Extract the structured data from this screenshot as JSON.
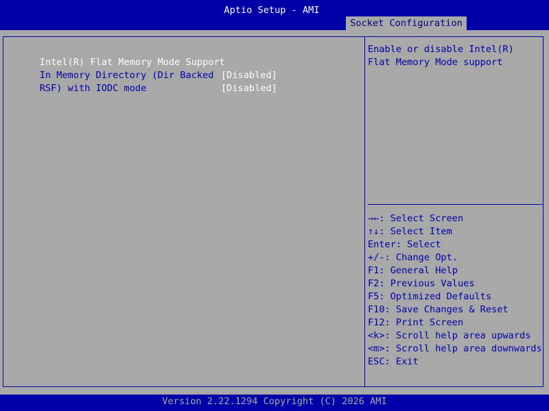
{
  "header": {
    "title": "Aptio Setup - AMI",
    "tab": "Socket Configuration"
  },
  "settings": [
    {
      "label_line1": "Intel(R) Flat Memory Mode Support",
      "label_line2": "",
      "value": "[Disabled]",
      "selected": true
    },
    {
      "label_line1": "In Memory Directory (Dir Backed",
      "label_line2": "RSF) with IODC mode",
      "value": "[Disabled]",
      "selected": false
    }
  ],
  "help": {
    "line1": "Enable or disable Intel(R)",
    "line2": "Flat Memory Mode support"
  },
  "keys": [
    "→←: Select Screen",
    "↑↓: Select Item",
    "Enter: Select",
    "+/-: Change Opt.",
    "F1: General Help",
    "F2: Previous Values",
    "F5: Optimized Defaults",
    "F10: Save Changes & Reset",
    "F12: Print Screen",
    "<k>: Scroll help area upwards",
    "<m>: Scroll help area downwards",
    "ESC: Exit"
  ],
  "footer": {
    "version": "Version 2.22.1294 Copyright (C) 2026 AMI"
  },
  "colors": {
    "bar_blue": "#0000a8",
    "panel_gray": "#a8a8a8",
    "selected_text": "#ffffff"
  }
}
